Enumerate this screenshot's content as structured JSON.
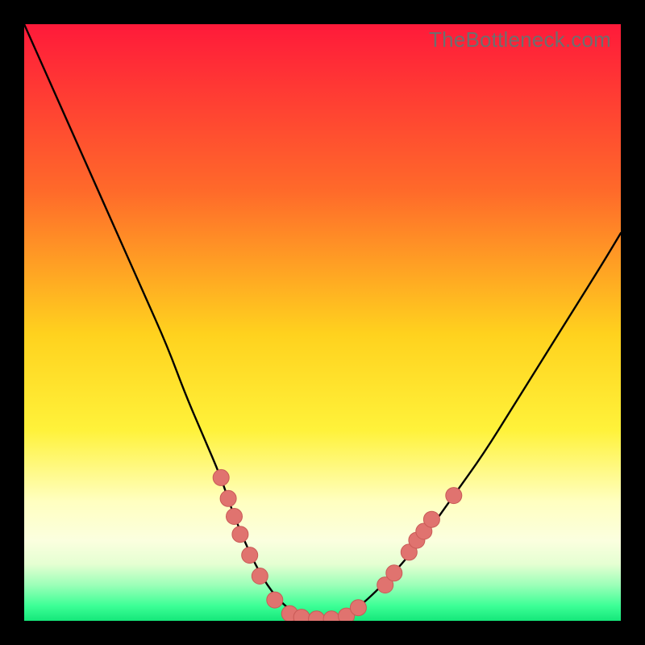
{
  "watermark": {
    "text": "TheBottleneck.com"
  },
  "colors": {
    "black": "#000000",
    "red": "#ff1a3a",
    "orange": "#ff8a1e",
    "yellow": "#ffe92e",
    "paleyellow": "#ffffbd",
    "green_light": "#b3ffb3",
    "green": "#1eff86",
    "curve": "#000000",
    "marker_fill": "#e0736f",
    "marker_stroke": "#c95a56"
  },
  "chart_data": {
    "type": "line",
    "title": "",
    "xlabel": "",
    "ylabel": "",
    "x_range": [
      0,
      100
    ],
    "y_range": [
      0,
      100
    ],
    "series": [
      {
        "name": "curve",
        "x": [
          0,
          4,
          8,
          12,
          16,
          20,
          24,
          27,
          30,
          33,
          35,
          37.5,
          40,
          43,
          46,
          50,
          54,
          57,
          62,
          67,
          72,
          77,
          82,
          87,
          92,
          97,
          100
        ],
        "y": [
          100,
          91,
          82,
          73,
          64,
          55,
          46,
          38,
          31,
          24,
          18,
          12,
          7,
          3,
          1,
          0,
          1,
          3,
          8,
          14,
          21,
          28,
          36,
          44,
          52,
          60,
          65
        ]
      }
    ],
    "markers": [
      {
        "x": 33.0,
        "y": 24.0
      },
      {
        "x": 34.2,
        "y": 20.5
      },
      {
        "x": 35.2,
        "y": 17.5
      },
      {
        "x": 36.2,
        "y": 14.5
      },
      {
        "x": 37.8,
        "y": 11.0
      },
      {
        "x": 39.5,
        "y": 7.5
      },
      {
        "x": 42.0,
        "y": 3.5
      },
      {
        "x": 44.5,
        "y": 1.2
      },
      {
        "x": 46.5,
        "y": 0.6
      },
      {
        "x": 49.0,
        "y": 0.3
      },
      {
        "x": 51.5,
        "y": 0.3
      },
      {
        "x": 54.0,
        "y": 0.8
      },
      {
        "x": 56.0,
        "y": 2.2
      },
      {
        "x": 60.5,
        "y": 6.0
      },
      {
        "x": 62.0,
        "y": 8.0
      },
      {
        "x": 64.5,
        "y": 11.5
      },
      {
        "x": 65.8,
        "y": 13.5
      },
      {
        "x": 67.0,
        "y": 15.0
      },
      {
        "x": 68.3,
        "y": 17.0
      },
      {
        "x": 72.0,
        "y": 21.0
      }
    ],
    "gradient_stops": [
      {
        "offset": 0.0,
        "color": "#ff1a3a"
      },
      {
        "offset": 0.28,
        "color": "#ff6a2a"
      },
      {
        "offset": 0.52,
        "color": "#ffd21e"
      },
      {
        "offset": 0.68,
        "color": "#fff23a"
      },
      {
        "offset": 0.8,
        "color": "#ffffc0"
      },
      {
        "offset": 0.865,
        "color": "#fbffdf"
      },
      {
        "offset": 0.905,
        "color": "#e5ffd2"
      },
      {
        "offset": 0.94,
        "color": "#9cffb8"
      },
      {
        "offset": 0.975,
        "color": "#3cff96"
      },
      {
        "offset": 1.0,
        "color": "#15e77a"
      }
    ]
  }
}
